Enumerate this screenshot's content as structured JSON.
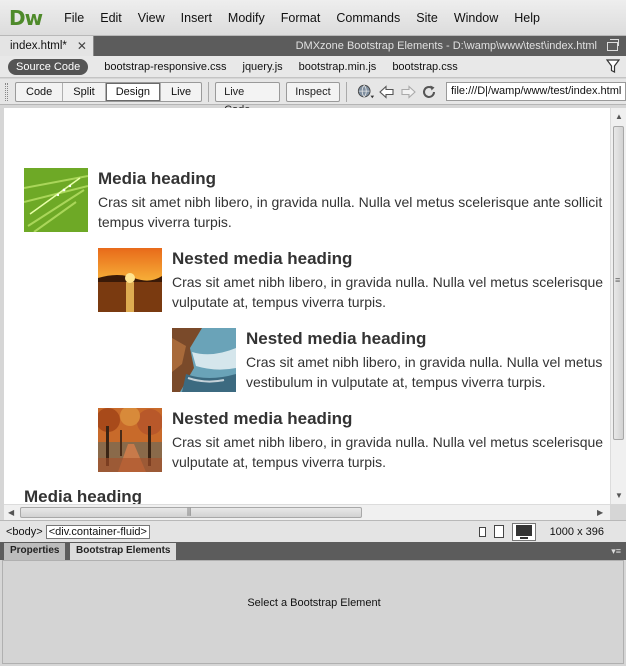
{
  "app": {
    "logo": "Dw"
  },
  "menu": [
    "File",
    "Edit",
    "View",
    "Insert",
    "Modify",
    "Format",
    "Commands",
    "Site",
    "Window",
    "Help"
  ],
  "doc_tab": {
    "label": "index.html*",
    "close": "✕"
  },
  "window_title": "DMXzone Bootstrap Elements - D:\\wamp\\www\\test\\index.html",
  "related_files": {
    "source": "Source Code",
    "files": [
      "bootstrap-responsive.css",
      "jquery.js",
      "bootstrap.min.js",
      "bootstrap.css"
    ]
  },
  "toolbar": {
    "views": [
      "Code",
      "Split",
      "Design",
      "Live"
    ],
    "active_view": "Design",
    "live_code": "Live Code",
    "inspect": "Inspect",
    "address": "file:///D|/wamp/www/test/index.html"
  },
  "media_items": [
    {
      "heading": "Media heading",
      "line1": "Cras sit amet nibh libero, in gravida nulla. Nulla vel metus scelerisque ante sollicit",
      "line2": "tempus viverra turpis.",
      "image": "grass"
    },
    {
      "heading": "Nested media heading",
      "line1": "Cras sit amet nibh libero, in gravida nulla. Nulla vel metus scelerisque",
      "line2": "vulputate at, tempus viverra turpis.",
      "image": "sunset"
    },
    {
      "heading": "Nested media heading",
      "line1": "Cras sit amet nibh libero, in gravida nulla. Nulla vel metus",
      "line2": "vestibulum in vulputate at, tempus viverra turpis.",
      "image": "coast"
    },
    {
      "heading": "Nested media heading",
      "line1": "Cras sit amet nibh libero, in gravida nulla. Nulla vel metus scelerisque",
      "line2": "vulputate at, tempus viverra turpis.",
      "image": "autumn"
    }
  ],
  "cut_heading": "Media heading",
  "status": {
    "tag_body": "<body>",
    "tag_div": "<div.container-fluid>",
    "dimensions": "1000 x 396"
  },
  "panel": {
    "tabs": [
      "Properties",
      "Bootstrap Elements"
    ],
    "message": "Select a Bootstrap Element"
  },
  "colors": {
    "logo": "#4e8a2a",
    "tab_strip": "#5c5c5c"
  }
}
